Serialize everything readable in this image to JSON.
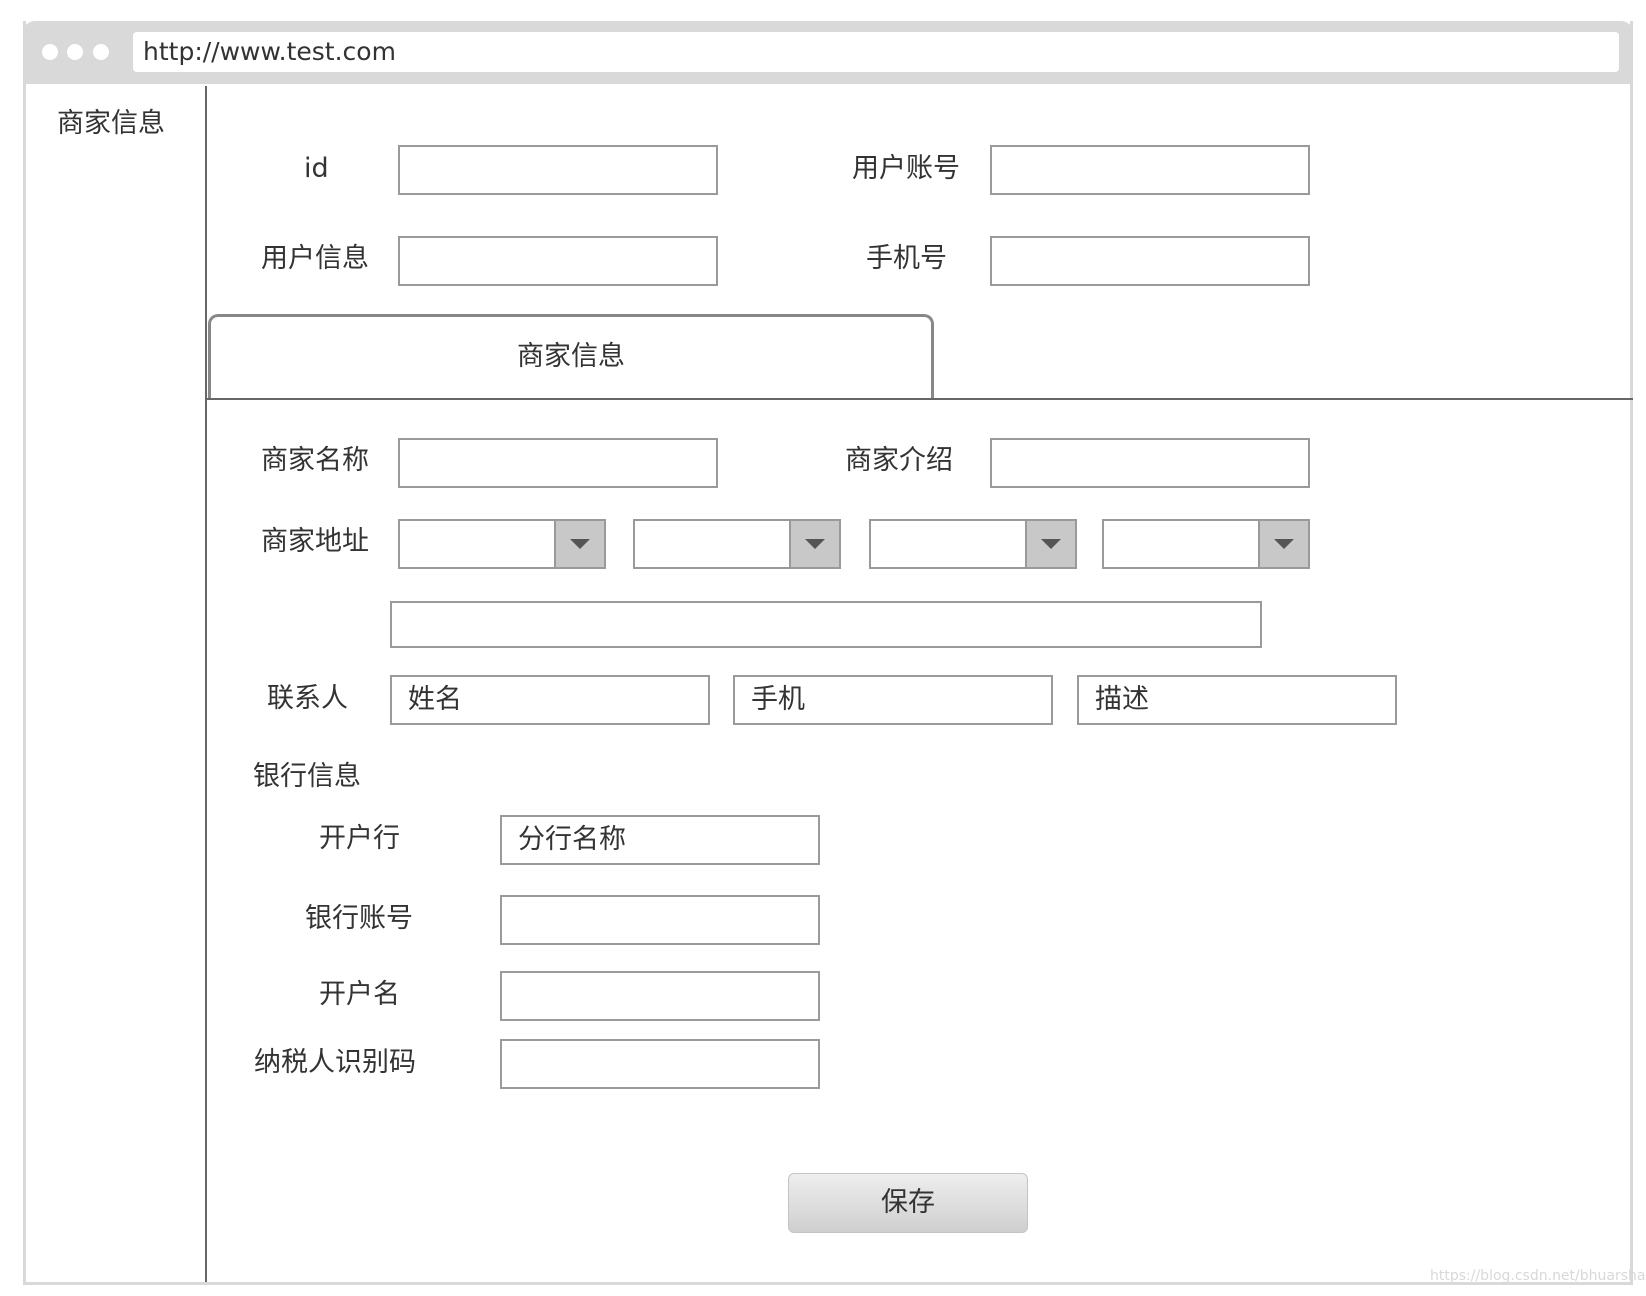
{
  "browser": {
    "url": "http://www.test.com"
  },
  "sidebar": {
    "title": "商家信息"
  },
  "user": {
    "id_label": "id",
    "id_value": "",
    "account_label": "用户账号",
    "account_value": "",
    "info_label": "用户信息",
    "info_value": "",
    "phone_label": "手机号",
    "phone_value": ""
  },
  "tabs": [
    {
      "label": "商家信息",
      "active": true
    }
  ],
  "merchant": {
    "name_label": "商家名称",
    "name_value": "",
    "intro_label": "商家介绍",
    "intro_value": "",
    "address_label": "商家地址",
    "address_selects": [
      "",
      "",
      "",
      ""
    ],
    "address_detail": ""
  },
  "contact": {
    "label": "联系人",
    "name_placeholder": "姓名",
    "phone_placeholder": "手机",
    "desc_placeholder": "描述"
  },
  "bank": {
    "section_title": "银行信息",
    "branch_label": "开户行",
    "branch_placeholder": "分行名称",
    "account_label": "银行账号",
    "account_value": "",
    "holder_label": "开户名",
    "holder_value": "",
    "tax_label": "纳税人识别码",
    "tax_value": ""
  },
  "actions": {
    "save_label": "保存"
  },
  "watermark": "https://blog.csdn.net/bhuarshar"
}
